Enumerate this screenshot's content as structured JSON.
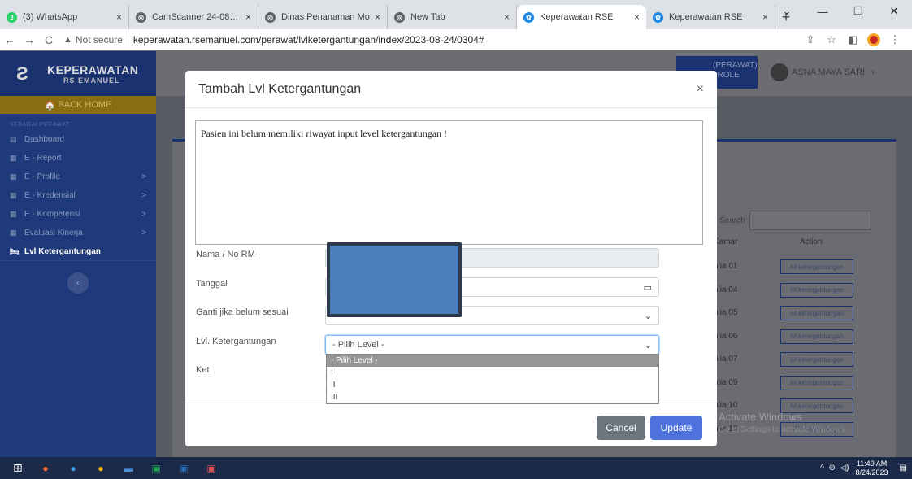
{
  "browser": {
    "tabs": [
      {
        "title": "(3) WhatsApp",
        "color": "#25d366",
        "glyph": "3"
      },
      {
        "title": "CamScanner 24-08-20",
        "color": "#5f6368",
        "glyph": "◎"
      },
      {
        "title": "Dinas Penanaman Mo",
        "color": "#5f6368",
        "glyph": "◎"
      },
      {
        "title": "New Tab",
        "color": "#5f6368",
        "glyph": "◎"
      },
      {
        "title": "Keperawatan RSE",
        "color": "#1e88e5",
        "glyph": "✿",
        "active": true
      },
      {
        "title": "Keperawatan RSE",
        "color": "#1e88e5",
        "glyph": "✿"
      }
    ],
    "not_secure": "Not secure",
    "url": "keperawatan.rsemanuel.com/perawat/lvlketergantungan/index/2023-08-24/0304#"
  },
  "sidebar": {
    "brand_title": "KEPERAWATAN",
    "brand_sub": "RS EMANUEL",
    "back_home": "BACK HOME",
    "section": "SEBAGAI PERAWAT",
    "items": [
      {
        "label": "Dashboard",
        "icon": "▤",
        "arrow": ""
      },
      {
        "label": "E - Report",
        "icon": "▦",
        "arrow": ""
      },
      {
        "label": "E - Profile",
        "icon": "▦",
        "arrow": ">"
      },
      {
        "label": "E - Kredensial",
        "icon": "▦",
        "arrow": ">"
      },
      {
        "label": "E - Kompetensi",
        "icon": "▦",
        "arrow": ">"
      },
      {
        "label": "Evaluasi Kinerja",
        "icon": "▦",
        "arrow": ">"
      },
      {
        "label": "Lvl Ketergantungan",
        "icon": "🛏",
        "arrow": "",
        "active": true
      }
    ]
  },
  "topnav": {
    "role_line1": "(PERAWAT)",
    "role_line2": "I ROLE",
    "user_name": "ASNA MAYA SARI"
  },
  "background_table": {
    "search_label": "Search:",
    "col_kamar": "Kamar",
    "col_action": "Action",
    "rows": [
      "hlia 01",
      "hlia 04",
      "hlia 05",
      "hlia 06",
      "hlia 07",
      "hlia 09",
      "hlia 10",
      "hlia 13"
    ],
    "btn_label": "lvl ketergantungan"
  },
  "modal": {
    "title": "Tambah Lvl Ketergantungan",
    "message": "Pasien ini belum memiliki riwayat input level ketergantungan !",
    "labels": {
      "nama": "Nama / No RM",
      "tanggal": "Tanggal",
      "ganti": "Ganti jika belum sesuai",
      "level": "Lvl. Ketergantungan",
      "ket": "Ket"
    },
    "level_selected": "- Pilih Level -",
    "level_options": [
      "- Pilih Level -",
      "I",
      "II",
      "III"
    ],
    "cancel": "Cancel",
    "update": "Update"
  },
  "watermark": {
    "line1": "Activate Windows",
    "line2": "Go to Settings to activate Windows."
  },
  "taskbar": {
    "time": "11:49 AM",
    "date": "8/24/2023"
  }
}
